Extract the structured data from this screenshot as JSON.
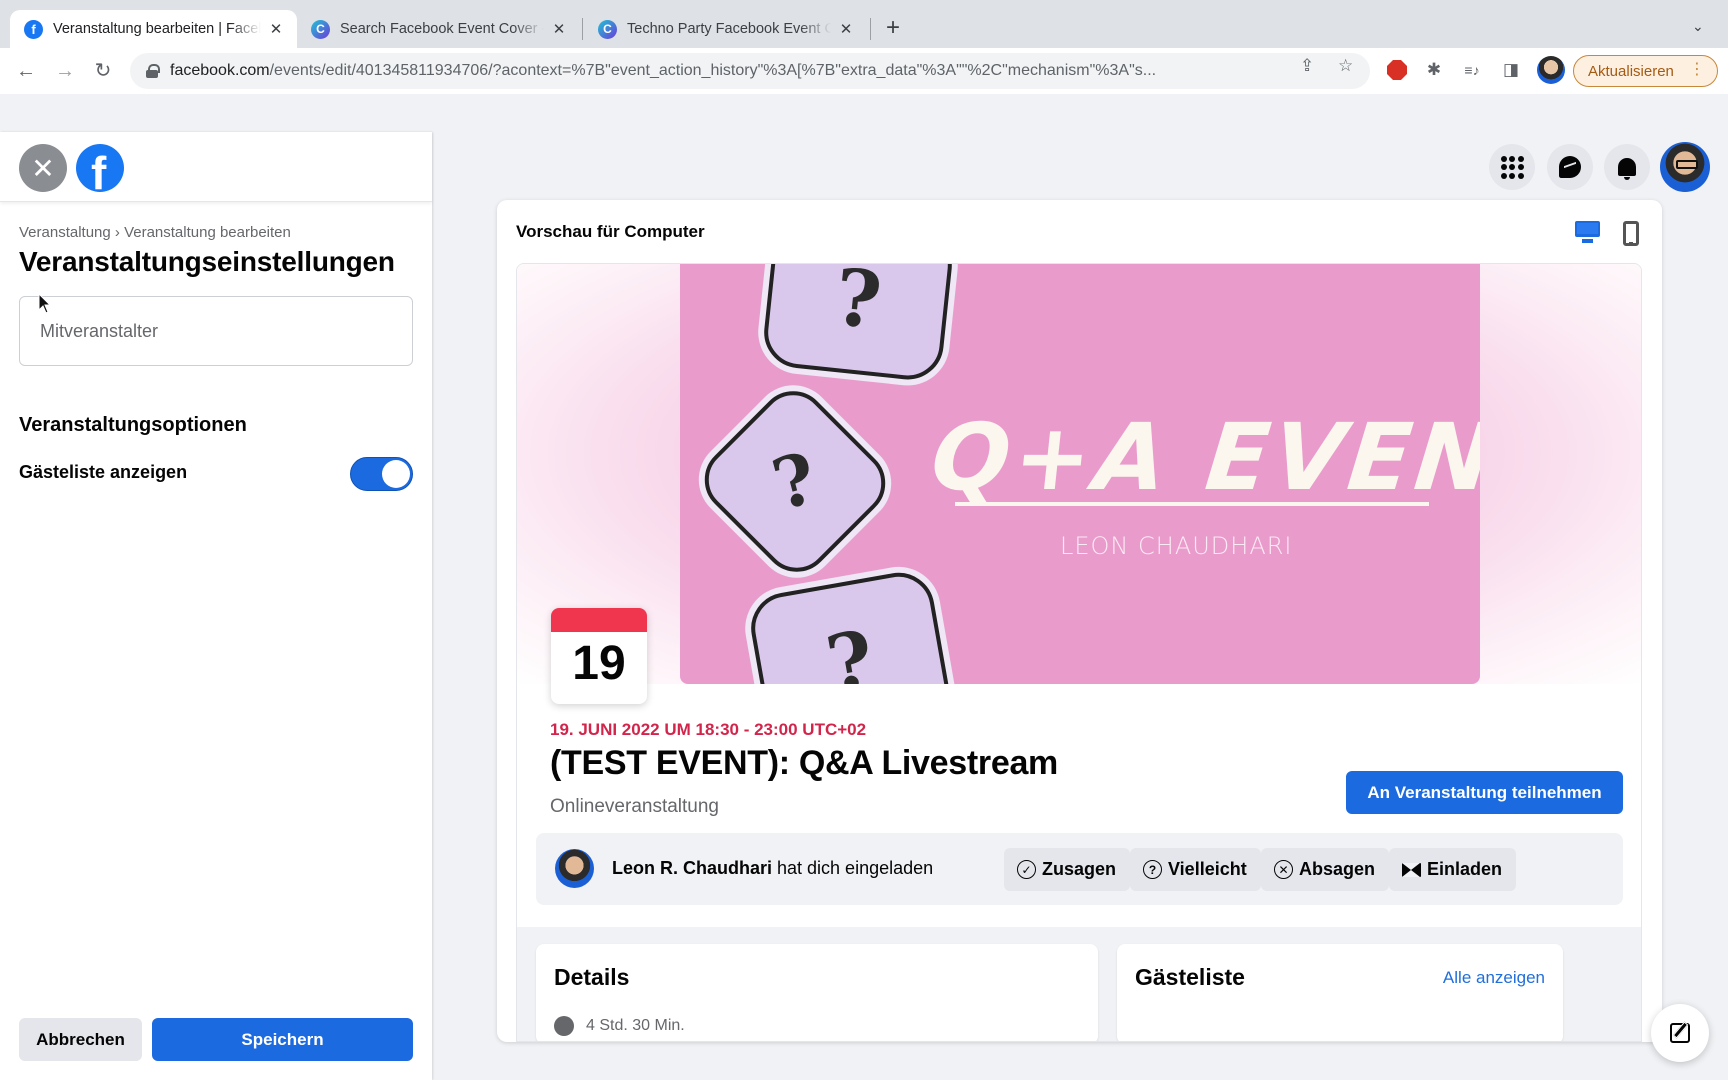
{
  "browser": {
    "tabs": [
      {
        "title": "Veranstaltung bearbeiten | Facebook",
        "favicon": "facebook-icon",
        "active": true
      },
      {
        "title": "Search Facebook Event Cover - Canva",
        "favicon": "canva-icon",
        "active": false
      },
      {
        "title": "Techno Party Facebook Event Cover",
        "favicon": "canva-icon",
        "active": false
      }
    ],
    "tab_close_glyph": "✕",
    "new_tab_glyph": "+",
    "tab_search_glyph": "⌄",
    "nav": {
      "back": "←",
      "forward": "→",
      "reload": "↻"
    },
    "url_host": "facebook.com",
    "url_path": "/events/edit/401345811934706/?acontext=%7B\"event_action_history\"%3A[%7B\"extra_data\"%3A\"\"%2C\"mechanism\"%3A\"s...",
    "omnibox_icons": {
      "share": "⇪",
      "bookmark": "☆"
    },
    "extensions": {
      "puzzle": "✱",
      "media": "≡♪",
      "sidebar": "◨"
    },
    "update_button": "Aktualisieren",
    "menu_glyph": "⋮"
  },
  "left_panel": {
    "close_glyph": "✕",
    "logo_glyph": "f",
    "breadcrumb": "Veranstaltung › Veranstaltung bearbeiten",
    "title": "Veranstaltungseinstellungen",
    "cohost_placeholder": "Mitveranstalter",
    "options_title": "Veranstaltungsoptionen",
    "guest_list_label": "Gästeliste anzeigen",
    "guest_list_enabled": true,
    "cancel_label": "Abbrechen",
    "save_label": "Speichern"
  },
  "preview": {
    "title": "Vorschau für Computer",
    "mode": "desktop",
    "cover": {
      "headline": "Q+A EVENT",
      "subtitle": "LEON CHAUDHARI",
      "bubble_glyph": "?"
    },
    "calendar_day": "19",
    "date_line": "19. JUNI 2022 UM 18:30 - 23:00 UTC+02",
    "event_title": "(TEST EVENT): Q&A Livestream",
    "event_type": "Onlineveranstaltung",
    "join_button": "An Veranstaltung teilnehmen",
    "invite": {
      "inviter": "Leon R. Chaudhari",
      "text": " hat dich eingeladen"
    },
    "rsvp_buttons": [
      {
        "label": "Zusagen",
        "icon": "check-circle-icon",
        "glyph": "✓"
      },
      {
        "label": "Vielleicht",
        "icon": "question-circle-icon",
        "glyph": "?"
      },
      {
        "label": "Absagen",
        "icon": "x-circle-icon",
        "glyph": "✕"
      },
      {
        "label": "Einladen",
        "icon": "envelope-icon",
        "glyph": ""
      }
    ],
    "details_title": "Details",
    "details_first_row": "4 Std. 30 Min.",
    "guestlist_title": "Gästeliste",
    "guestlist_link": "Alle anzeigen"
  },
  "colors": {
    "fb_blue": "#1b6ae0",
    "date_red": "#d2254b",
    "calendar_red": "#f0354f",
    "cover_pink": "#e99ccb"
  }
}
